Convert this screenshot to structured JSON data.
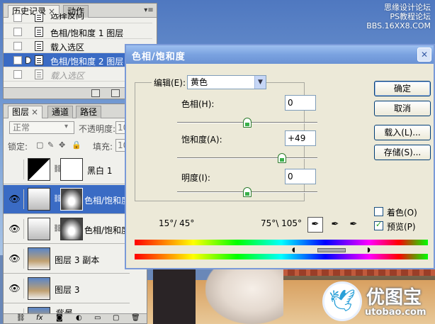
{
  "watermark": {
    "top_line1": "思缘设计论坛",
    "top_line2": "PS教程论坛",
    "top_line3": "BBS.16XX8.COM",
    "logo_cn": "优图宝",
    "logo_url": "utobao.com"
  },
  "history_panel": {
    "tabs": [
      "历史记录",
      "动作"
    ],
    "rows": [
      {
        "label": "选择反向",
        "state": "normal"
      },
      {
        "label": "色相/饱和度 1 图层",
        "state": "normal"
      },
      {
        "label": "载入选区",
        "state": "normal"
      },
      {
        "label": "色相/饱和度 2 图层",
        "state": "selected"
      },
      {
        "label": "载入选区",
        "state": "dimmed"
      }
    ]
  },
  "layers_panel": {
    "tabs": [
      "图层",
      "通道",
      "路径"
    ],
    "blend_mode": "正常",
    "opacity_label": "不透明度:",
    "opacity_value": "10",
    "lock_label": "锁定:",
    "fill_label": "填充:",
    "fill_value": "10",
    "layers": [
      {
        "name": "黑白 1",
        "visible": false,
        "selected": false
      },
      {
        "name": "色相/饱和度",
        "visible": true,
        "selected": true
      },
      {
        "name": "色相/饱和度",
        "visible": true,
        "selected": false
      },
      {
        "name": "图层 3 副本",
        "visible": true,
        "selected": false
      },
      {
        "name": "图层 3",
        "visible": true,
        "selected": false
      },
      {
        "name": "背景",
        "visible": true,
        "selected": false
      }
    ]
  },
  "dialog": {
    "title": "色相/饱和度",
    "edit_label": "编辑(E):",
    "edit_value": "黄色",
    "hue_label": "色相(H):",
    "hue_value": "0",
    "saturation_label": "饱和度(A):",
    "saturation_value": "+49",
    "lightness_label": "明度(I):",
    "lightness_value": "0",
    "slider_levels": {
      "hue": 0.5,
      "saturation": 0.745,
      "lightness": 0.5
    },
    "buttons": {
      "ok": "确定",
      "cancel": "取消",
      "load": "载入(L)...",
      "save": "存储(S)..."
    },
    "colorize_label": "着色(O)",
    "colorize_checked": false,
    "preview_label": "预览(P)",
    "preview_checked": true,
    "range_left": "15°/ 45°",
    "range_right": "75°\\ 105°"
  }
}
